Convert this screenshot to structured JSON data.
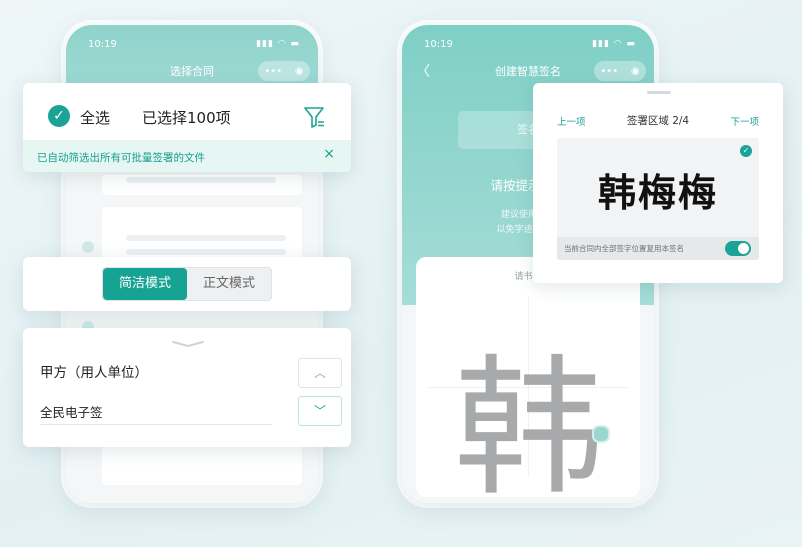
{
  "phone_left": {
    "status_time": "10:19",
    "status_icons": "▮▮▮ ◠ ▬",
    "nav_title": "选择合同",
    "capsule_more": "•••",
    "capsule_close": "◉"
  },
  "phone_right": {
    "status_time": "10:19",
    "status_icons": "▮▮▮ ◠ ▬",
    "nav_back": "〈",
    "nav_title": "创建智慧签名",
    "capsule_more": "•••",
    "capsule_close": "◉",
    "ghost_button": "签名",
    "prompt": "请按提示书写",
    "tip_line1": "建议使用楷书",
    "tip_line2": "以免字迹原因无",
    "pad_hint": "请书写",
    "trace_char": "韩"
  },
  "select_card": {
    "select_all_label": "全选",
    "selected_count_label": "已选择100项",
    "notice_text": "已自动筛选出所有可批量签署的文件",
    "notice_close": "×",
    "check_glyph": "✓"
  },
  "mode_card": {
    "simple_mode": "简洁模式",
    "full_text_mode": "正文模式"
  },
  "party_card": {
    "party_label": "甲方（用人单位）",
    "party_value": "全民电子签",
    "up_glyph": "︿",
    "down_glyph": "﹀"
  },
  "sign_card": {
    "prev_label": "上一项",
    "title": "签署区域 2/4",
    "next_label": "下一项",
    "signature_text": "韩梅梅",
    "reuse_label": "当前合同内全部签字位置复用本签名",
    "reuse_enabled": true,
    "check_glyph": "✓"
  },
  "colors": {
    "accent": "#1aa396",
    "header_teal": "#8fd3cc",
    "notice_bg": "#e6f6f3"
  }
}
